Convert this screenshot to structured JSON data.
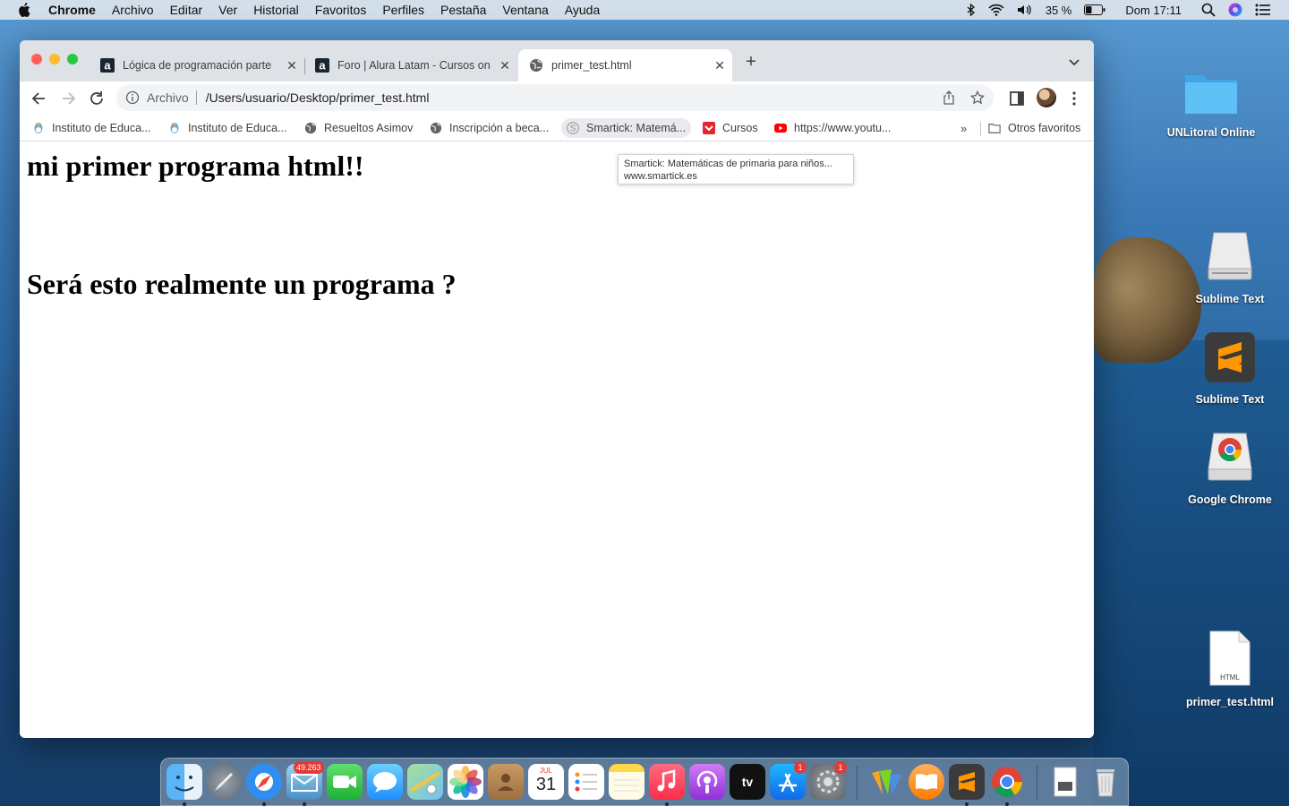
{
  "menubar": {
    "app_name": "Chrome",
    "menus": [
      "Archivo",
      "Editar",
      "Ver",
      "Historial",
      "Favoritos",
      "Perfiles",
      "Pestaña",
      "Ventana",
      "Ayuda"
    ],
    "battery": "35 %",
    "clock": "Dom 17:11"
  },
  "tabs": [
    {
      "title": "Lógica de programación parte",
      "icon": "alura-icon",
      "active": false
    },
    {
      "title": "Foro | Alura Latam - Cursos on",
      "icon": "alura-icon",
      "active": false
    },
    {
      "title": "primer_test.html",
      "icon": "globe-icon",
      "active": true
    }
  ],
  "address_bar": {
    "scheme_label": "Archivo",
    "url": "/Users/usuario/Desktop/primer_test.html"
  },
  "bookmarks": [
    {
      "label": "Instituto de Educa...",
      "icon": "argentina-seal-icon"
    },
    {
      "label": "Instituto de Educa...",
      "icon": "argentina-seal-icon"
    },
    {
      "label": "Resueltos Asimov",
      "icon": "globe-icon"
    },
    {
      "label": "Inscripción a beca...",
      "icon": "globe-icon"
    },
    {
      "label": "Smartick: Matemá...",
      "icon": "smartick-icon"
    },
    {
      "label": "Cursos",
      "icon": "cursos-icon"
    },
    {
      "label": "https://www.youtu...",
      "icon": "youtube-icon"
    }
  ],
  "other_bookmarks": "Otros favoritos",
  "tooltip": {
    "title": "Smartick: Matemáticas de primaria para niños...",
    "url": "www.smartick.es"
  },
  "page": {
    "heading1": "mi primer programa html!!",
    "heading2": "Será esto realmente un programa ?"
  },
  "desktop_icons": [
    {
      "label": "UNLitoral Online",
      "icon": "folder-icon"
    },
    {
      "label": "Sublime Text",
      "icon": "disk-icon"
    },
    {
      "label": "Sublime Text",
      "icon": "sublime-icon"
    },
    {
      "label": "Google Chrome",
      "icon": "chrome-disk-icon"
    },
    {
      "label": "primer_test.html",
      "icon": "html-file-icon",
      "file_tag": "HTML"
    }
  ],
  "dock": {
    "mail_badge": "49.263",
    "calendar_month": "JUL",
    "calendar_day": "31",
    "appstore_badge": "1",
    "settings_badge": "1",
    "appletv_label": "tv"
  },
  "colors": {
    "tab_strip": "#dee1e6",
    "omnibox": "#f1f3f4",
    "traffic_red": "#fe5f57",
    "traffic_yellow": "#febc2e",
    "traffic_green": "#28c840"
  }
}
